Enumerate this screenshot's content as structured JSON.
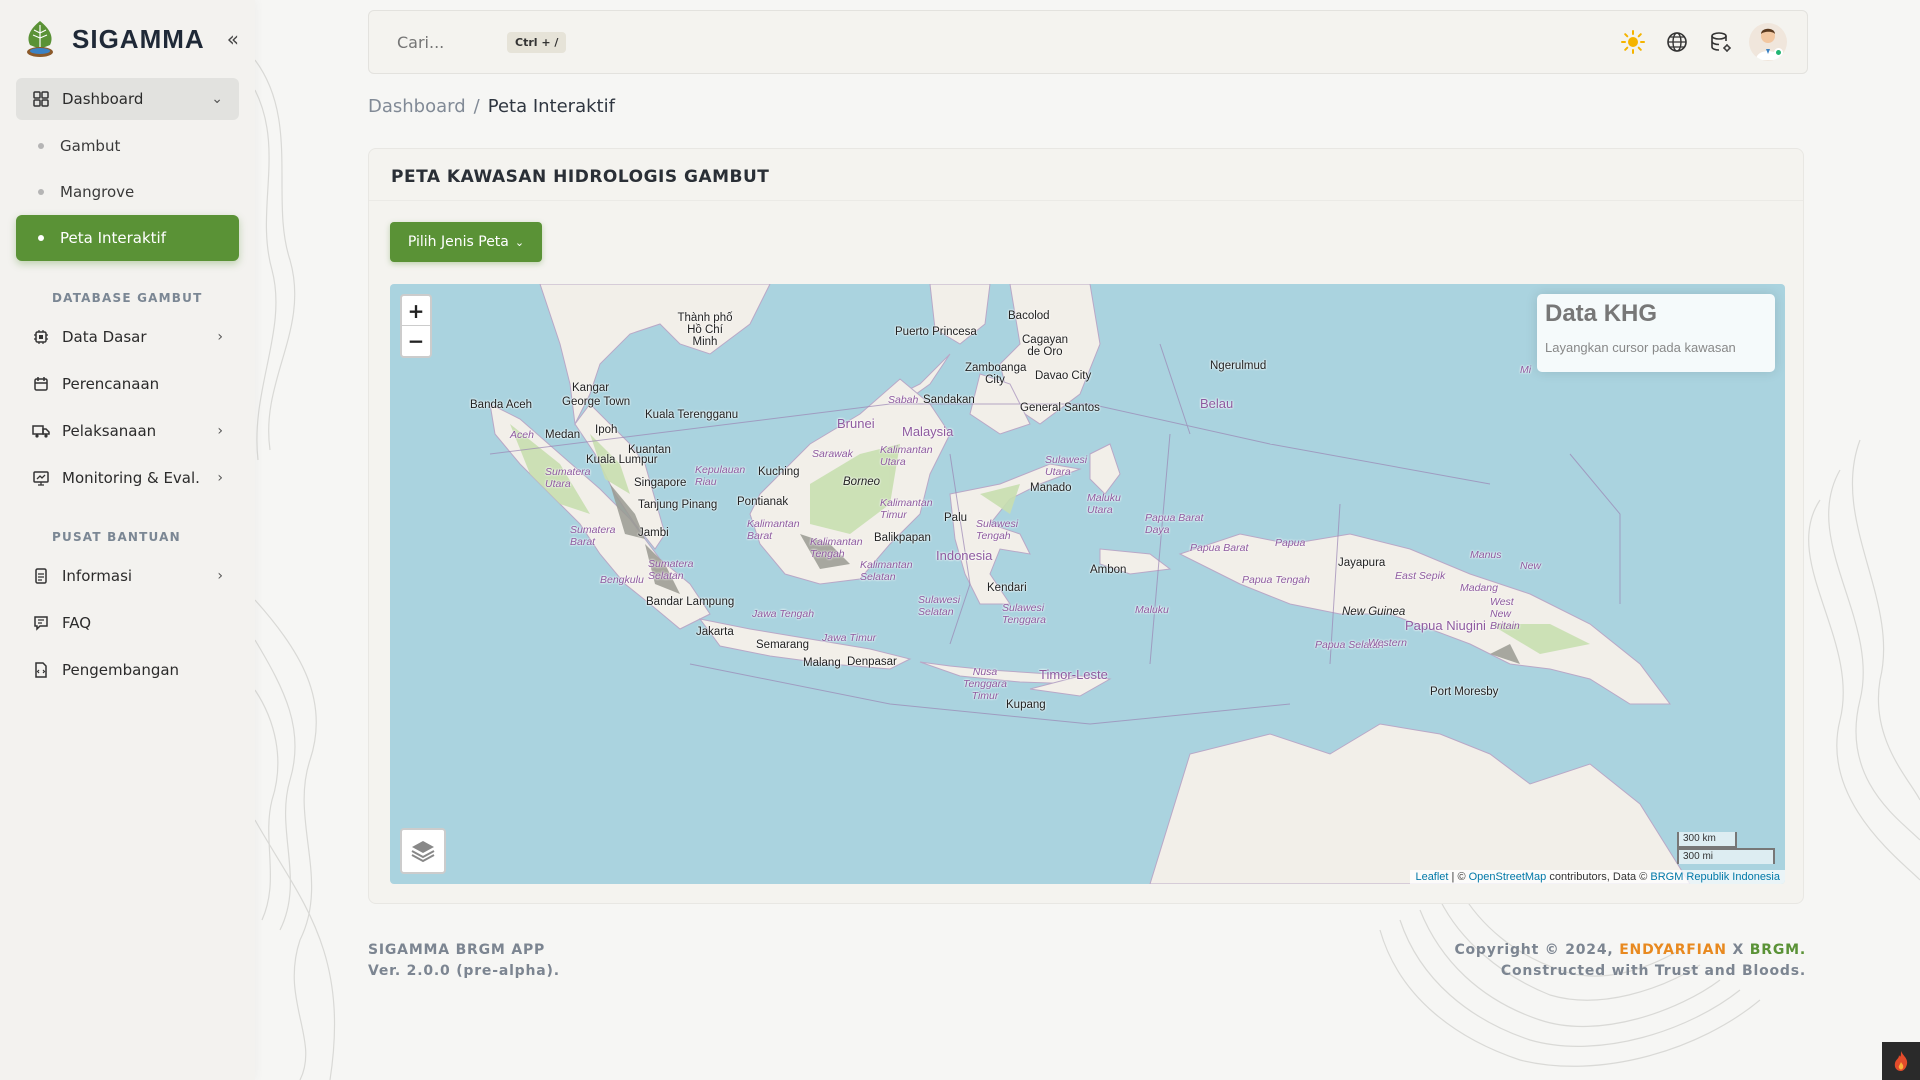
{
  "brand": {
    "name": "SIGAMMA"
  },
  "sidebar": {
    "dashboard": {
      "label": "Dashboard",
      "children": [
        {
          "label": "Gambut"
        },
        {
          "label": "Mangrove"
        },
        {
          "label": "Peta Interaktif"
        }
      ]
    },
    "section_database": "DATABASE GAMBUT",
    "database_items": [
      {
        "label": "Data Dasar"
      },
      {
        "label": "Perencanaan"
      },
      {
        "label": "Pelaksanaan"
      },
      {
        "label": "Monitoring & Eval."
      }
    ],
    "section_help": "PUSAT BANTUAN",
    "help_items": [
      {
        "label": "Informasi"
      },
      {
        "label": "FAQ"
      },
      {
        "label": "Pengembangan"
      }
    ]
  },
  "topbar": {
    "search_placeholder": "Cari...",
    "shortcut": "Ctrl + /"
  },
  "breadcrumb": {
    "parent": "Dashboard",
    "separator": "/",
    "current": "Peta Interaktif"
  },
  "card": {
    "title": "PETA KAWASAN HIDROLOGIS GAMBUT",
    "map_type_button": "Pilih Jenis Peta"
  },
  "map": {
    "zoom_in": "+",
    "zoom_out": "−",
    "info_title": "Data KHG",
    "info_hint": "Layangkan cursor pada kawasan",
    "scale_km": "300 km",
    "scale_mi": "300 mi",
    "attribution": {
      "leaflet": "Leaflet",
      "sep": " | © ",
      "osm": "OpenStreetMap",
      "contrib": " contributors, Data © ",
      "brgm": "BRGM Republik Indonesia"
    },
    "labels": {
      "hcm": "Thành phố Hồ Chí Minh",
      "bacolod": "Bacolod",
      "cagayan": "Cagayan de Oro",
      "puerto": "Puerto Princesa",
      "zamboanga": "Zamboanga City",
      "davao": "Davao City",
      "gensan": "General Santos",
      "ngerulmud": "Ngerulmud",
      "belau": "Belau",
      "banda": "Banda Aceh",
      "kangar": "Kangar",
      "georgetown": "George Town",
      "kualater": "Kuala Terengganu",
      "ipoh": "Ipoh",
      "medan": "Medan",
      "kuantan": "Kuantan",
      "kl": "Kuala Lumpur",
      "singapore": "Singapore",
      "tanjung": "Tanjung Pinang",
      "kuching": "Kuching",
      "brunei": "Brunei",
      "sandakan": "Sandakan",
      "malaysia": "Malaysia",
      "borneo": "Borneo",
      "pontianak": "Pontianak",
      "jambi": "Jambi",
      "palu": "Palu",
      "manado": "Manado",
      "balikpapan": "Balikpapan",
      "indonesia": "Indonesia",
      "kendari": "Kendari",
      "ambon": "Ambon",
      "jayapura": "Jayapura",
      "newguinea": "New Guinea",
      "papuanugini": "Papua Niugini",
      "bandarlampung": "Bandar Lampung",
      "jakarta": "Jakarta",
      "semarang": "Semarang",
      "malang": "Malang",
      "denpasar": "Denpasar",
      "timor": "Timor-Leste",
      "kupang": "Kupang",
      "moresby": "Port Moresby",
      "aceh": "Aceh",
      "sumut": "Sumatera Utara",
      "sumbar": "Sumatera Barat",
      "bengkulu": "Bengkulu",
      "sumsel": "Sumatera Selatan",
      "kalbar": "Kalimantan Barat",
      "kalteng": "Kalimantan Tengah",
      "kalsel": "Kalimantan Selatan",
      "kaltim": "Kalimantan Timur",
      "kalut": "Kalimantan Utara",
      "sarawak": "Sarawak",
      "sabah": "Sabah",
      "kepriau": "Kepulauan Riau",
      "jateng": "Jawa Tengah",
      "jatim": "Jawa Timur",
      "ntt": "Nusa Tenggara Timur",
      "sulut": "Sulawesi Utara",
      "sulteng": "Sulawesi Tengah",
      "sulsel": "Sulawesi Selatan",
      "sultra": "Sulawesi Tenggara",
      "malut": "Maluku Utara",
      "maluku": "Maluku",
      "papbd": "Papua Barat Daya",
      "papb": "Papua Barat",
      "papua": "Papua",
      "papteng": "Papua Tengah",
      "papsel": "Papua Selatan",
      "eastsepik": "East Sepik",
      "madang": "Madang",
      "manus": "Manus",
      "western": "Western",
      "wnb": "West New Britain",
      "mi": "Mi",
      "new": "New"
    }
  },
  "footer": {
    "app_name": "SIGAMMA BRGM APP",
    "version": "Ver. 2.0.0 (pre-alpha).",
    "copyright_prefix": "Copyright © 2024,",
    "author": "ENDYARFIAN",
    "x": "X",
    "org": "BRGM.",
    "tagline": "Constructed with Trust and Bloods."
  },
  "colors": {
    "accent_green": "#5a9236",
    "accent_orange": "#e8891f",
    "sea": "#aad3df",
    "land": "#f2efe9"
  },
  "icons": {
    "theme": "sun-icon",
    "language": "globe-icon",
    "database": "database-settings-icon"
  }
}
